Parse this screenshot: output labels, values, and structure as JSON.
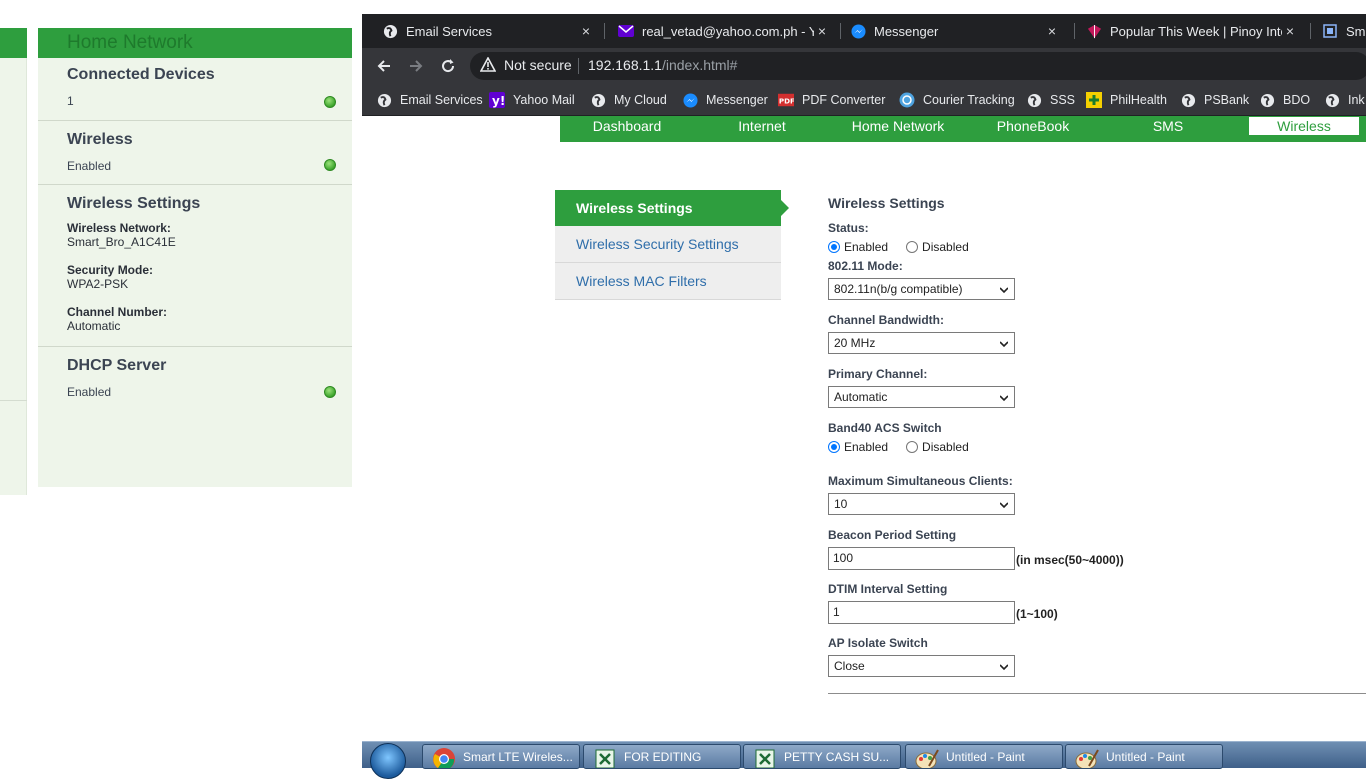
{
  "status_panel": {
    "header": "Home Network",
    "connected_devices": {
      "title": "Connected Devices",
      "value": "1"
    },
    "wireless": {
      "title": "Wireless",
      "value": "Enabled"
    },
    "wireless_settings": {
      "title": "Wireless Settings",
      "network_label": "Wireless Network:",
      "network_value": "Smart_Bro_A1C41E",
      "security_label": "Security Mode:",
      "security_value": "WPA2-PSK",
      "channel_label": "Channel Number:",
      "channel_value": "Automatic"
    },
    "dhcp": {
      "title": "DHCP Server",
      "value": "Enabled"
    }
  },
  "browser": {
    "tabs": [
      {
        "title": "Email Services",
        "icon": "globe-icon",
        "close": "×"
      },
      {
        "title": "real_vetad@yahoo.com.ph - Yah",
        "icon": "yahoo-mail-icon",
        "close": "×"
      },
      {
        "title": "Messenger",
        "icon": "messenger-icon",
        "close": "×"
      },
      {
        "title": "Popular This Week | Pinoy Intern",
        "icon": "pinoy-icon",
        "close": "×"
      },
      {
        "title": "Sma",
        "icon": "page-icon"
      }
    ],
    "omnibox": {
      "security": "Not secure",
      "host": "192.168.1.1",
      "path": "/index.html#"
    },
    "bookmarks": [
      {
        "label": "Email Services",
        "icon": "globe-icon"
      },
      {
        "label": "Yahoo Mail",
        "icon": "yahoo-icon"
      },
      {
        "label": "My Cloud",
        "icon": "globe-icon"
      },
      {
        "label": "Messenger",
        "icon": "messenger-icon"
      },
      {
        "label": "PDF Converter",
        "icon": "pdf-icon"
      },
      {
        "label": "Courier Tracking",
        "icon": "courier-icon"
      },
      {
        "label": "SSS",
        "icon": "globe-icon"
      },
      {
        "label": "PhilHealth",
        "icon": "philhealth-icon"
      },
      {
        "label": "PSBank",
        "icon": "globe-icon"
      },
      {
        "label": "BDO",
        "icon": "globe-icon"
      },
      {
        "label": "Ink",
        "icon": "globe-icon"
      }
    ]
  },
  "router": {
    "nav": [
      "Dashboard",
      "Internet",
      "Home Network",
      "PhoneBook",
      "SMS",
      "Wireless"
    ],
    "active_nav": "Wireless",
    "side_menu": [
      "Wireless Settings",
      "Wireless Security Settings",
      "Wireless MAC Filters"
    ],
    "form": {
      "title": "Wireless Settings",
      "status_label": "Status:",
      "enabled": "Enabled",
      "disabled": "Disabled",
      "mode_label": "802.11 Mode:",
      "mode_value": "802.11n(b/g compatible)",
      "bandwidth_label": "Channel Bandwidth:",
      "bandwidth_value": "20 MHz",
      "primary_label": "Primary Channel:",
      "primary_value": "Automatic",
      "band40_label": "Band40 ACS Switch",
      "max_clients_label": "Maximum Simultaneous Clients:",
      "max_clients_value": "10",
      "beacon_label": "Beacon Period Setting",
      "beacon_value": "100",
      "beacon_hint": "(in msec(50~4000))",
      "dtim_label": "DTIM Interval Setting",
      "dtim_value": "1",
      "dtim_hint": "(1~100)",
      "ap_isolate_label": "AP Isolate Switch",
      "ap_isolate_value": "Close"
    }
  },
  "taskbar": {
    "items": [
      {
        "label": "Smart LTE Wireles...",
        "icon": "chrome-icon"
      },
      {
        "label": "FOR EDITING",
        "icon": "excel-icon"
      },
      {
        "label": "PETTY CASH SU...",
        "icon": "excel-icon"
      },
      {
        "label": "Untitled - Paint",
        "icon": "paint-icon"
      },
      {
        "label": "Untitled - Paint",
        "icon": "paint-icon"
      }
    ]
  },
  "colors": {
    "router_green": "#2e9e3e",
    "link_blue": "#2f6eaa",
    "chrome_dark": "#202124",
    "chrome_toolbar": "#35363a"
  }
}
